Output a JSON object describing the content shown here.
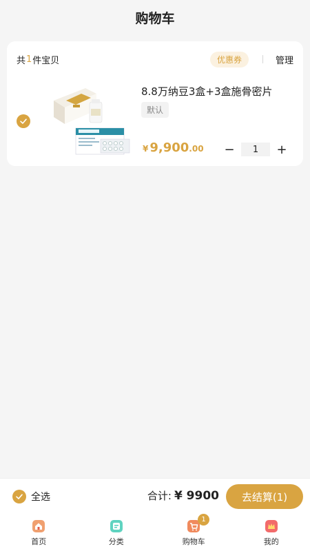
{
  "header": {
    "title": "购物车"
  },
  "cart": {
    "count_prefix": "共",
    "count": "1",
    "count_suffix": "件宝贝",
    "coupon_label": "优惠券",
    "manage_label": "管理"
  },
  "item": {
    "name": "8.8万纳豆3盒+3盒施骨密片",
    "spec": "默认",
    "price_symbol": "¥",
    "price_int": "9,900",
    "price_dec": ".00",
    "quantity": "1",
    "minus": "−",
    "plus": "+"
  },
  "footer": {
    "select_all_label": "全选",
    "total_label": "合计:",
    "total_amount": "¥ 9900",
    "checkout_label": "去结算(1)"
  },
  "tabs": [
    {
      "label": "首页",
      "icon": "home-icon"
    },
    {
      "label": "分类",
      "icon": "category-icon"
    },
    {
      "label": "购物车",
      "icon": "cart-icon",
      "badge": "1"
    },
    {
      "label": "我的",
      "icon": "profile-icon"
    }
  ],
  "colors": {
    "accent": "#d9a441",
    "accent_light": "#fbf1e0",
    "background": "#f5f5f5"
  }
}
